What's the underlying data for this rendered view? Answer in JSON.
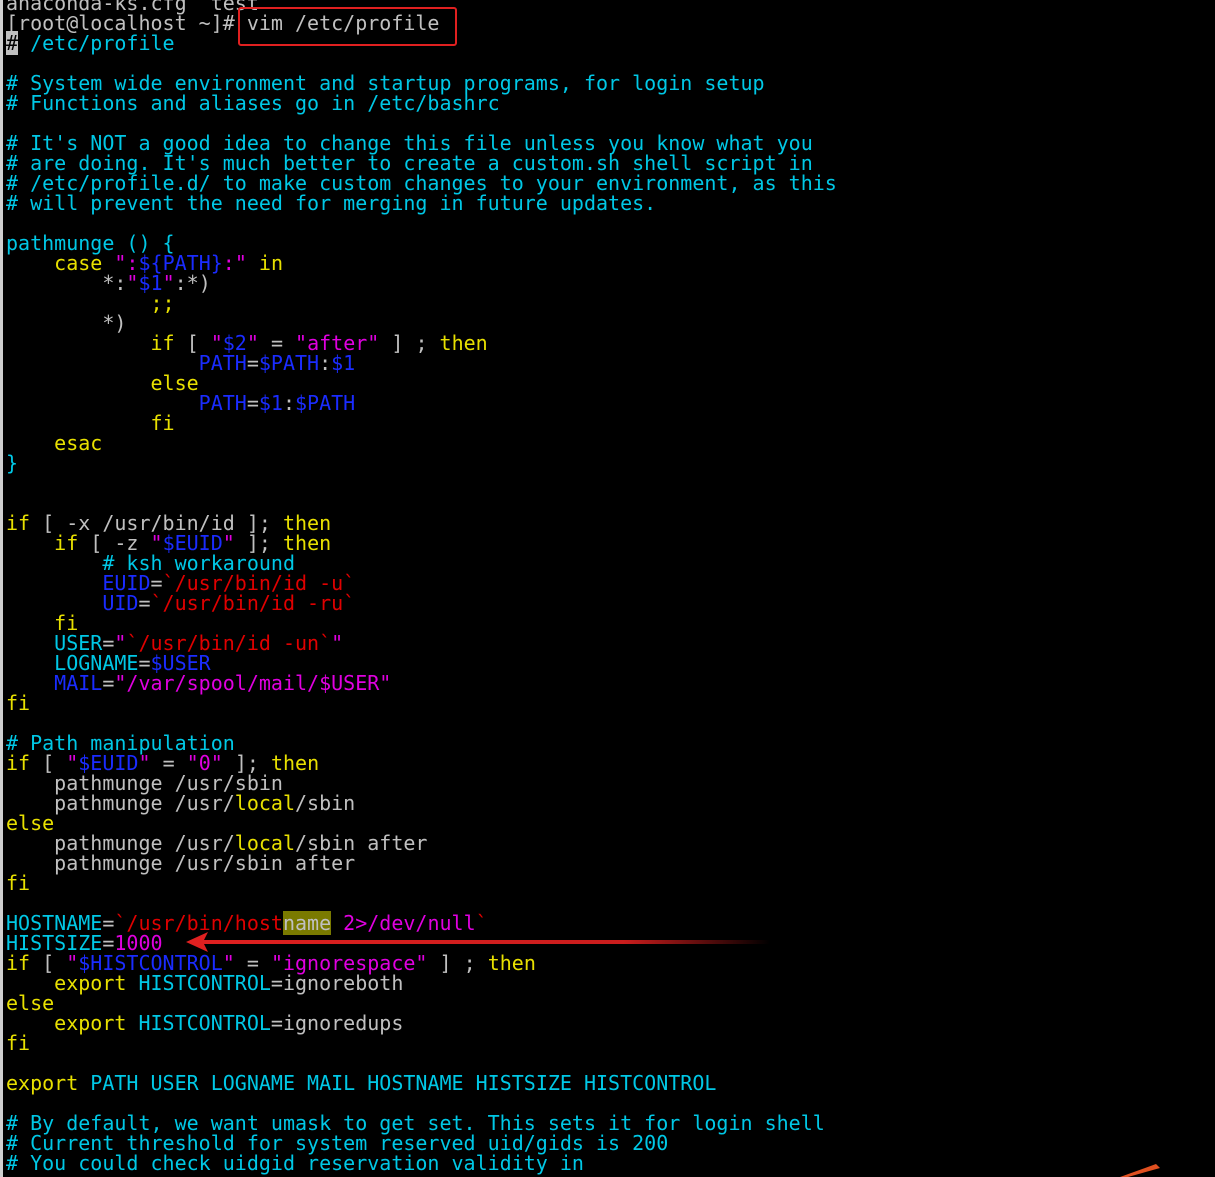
{
  "terminal": {
    "lines": [
      [
        [
          "default",
          "anaconda-ks.cfg  test"
        ]
      ],
      [
        [
          "default",
          "[root@localhost ~]# vim /etc/profile"
        ]
      ],
      [
        [
          "cursor",
          "#"
        ],
        [
          "comment",
          " /etc/profile"
        ]
      ],
      [],
      [
        [
          "comment",
          "# System wide environment and startup programs, for login setup"
        ]
      ],
      [
        [
          "comment",
          "# Functions and aliases go in /etc/bashrc"
        ]
      ],
      [],
      [
        [
          "comment",
          "# It's NOT a good idea to change this file unless you know what you"
        ]
      ],
      [
        [
          "comment",
          "# are doing. It's much better to create a custom.sh shell script in"
        ]
      ],
      [
        [
          "comment",
          "# /etc/profile.d/ to make custom changes to your environment, as this"
        ]
      ],
      [
        [
          "comment",
          "# will prevent the need for merging in future updates."
        ]
      ],
      [],
      [
        [
          "comment",
          "pathmunge () {"
        ]
      ],
      [
        [
          "default",
          "    "
        ],
        [
          "yellow",
          "case"
        ],
        [
          "default",
          " "
        ],
        [
          "str",
          "\":"
        ],
        [
          "var",
          "${PATH}"
        ],
        [
          "str",
          ":\""
        ],
        [
          "default",
          " "
        ],
        [
          "yellow",
          "in"
        ]
      ],
      [
        [
          "default",
          "        *:"
        ],
        [
          "str",
          "\""
        ],
        [
          "var",
          "$1"
        ],
        [
          "str",
          "\""
        ],
        [
          "default",
          ":*)"
        ]
      ],
      [
        [
          "default",
          "            "
        ],
        [
          "yellow",
          ";;"
        ]
      ],
      [
        [
          "default",
          "        *)"
        ]
      ],
      [
        [
          "default",
          "            "
        ],
        [
          "yellow",
          "if"
        ],
        [
          "default",
          " [ "
        ],
        [
          "str",
          "\""
        ],
        [
          "var",
          "$2"
        ],
        [
          "str",
          "\""
        ],
        [
          "default",
          " = "
        ],
        [
          "str",
          "\"after\""
        ],
        [
          "default",
          " ] ; "
        ],
        [
          "yellow",
          "then"
        ]
      ],
      [
        [
          "default",
          "                "
        ],
        [
          "var",
          "PATH"
        ],
        [
          "default",
          "="
        ],
        [
          "var",
          "$PATH"
        ],
        [
          "default",
          ":"
        ],
        [
          "var",
          "$1"
        ]
      ],
      [
        [
          "default",
          "            "
        ],
        [
          "yellow",
          "else"
        ]
      ],
      [
        [
          "default",
          "                "
        ],
        [
          "var",
          "PATH"
        ],
        [
          "default",
          "="
        ],
        [
          "var",
          "$1"
        ],
        [
          "default",
          ":"
        ],
        [
          "var",
          "$PATH"
        ]
      ],
      [
        [
          "default",
          "            "
        ],
        [
          "yellow",
          "fi"
        ]
      ],
      [
        [
          "default",
          "    "
        ],
        [
          "yellow",
          "esac"
        ]
      ],
      [
        [
          "comment",
          "}"
        ]
      ],
      [],
      [],
      [
        [
          "yellow",
          "if"
        ],
        [
          "default",
          " [ -x /usr/bin/id ]; "
        ],
        [
          "yellow",
          "then"
        ]
      ],
      [
        [
          "default",
          "    "
        ],
        [
          "yellow",
          "if"
        ],
        [
          "default",
          " [ -z "
        ],
        [
          "str",
          "\""
        ],
        [
          "var",
          "$EUID"
        ],
        [
          "str",
          "\""
        ],
        [
          "default",
          " ]; "
        ],
        [
          "yellow",
          "then"
        ]
      ],
      [
        [
          "default",
          "        "
        ],
        [
          "comment",
          "# ksh workaround"
        ]
      ],
      [
        [
          "default",
          "        "
        ],
        [
          "var",
          "EUID"
        ],
        [
          "default",
          "="
        ],
        [
          "red",
          "`/usr/bin/id -u`"
        ]
      ],
      [
        [
          "default",
          "        "
        ],
        [
          "var",
          "UID"
        ],
        [
          "default",
          "="
        ],
        [
          "red",
          "`/usr/bin/id -ru`"
        ]
      ],
      [
        [
          "default",
          "    "
        ],
        [
          "yellow",
          "fi"
        ]
      ],
      [
        [
          "default",
          "    "
        ],
        [
          "comment",
          "USER"
        ],
        [
          "default",
          "="
        ],
        [
          "str",
          "\""
        ],
        [
          "red",
          "`/usr/bin/id -un`"
        ],
        [
          "str",
          "\""
        ]
      ],
      [
        [
          "default",
          "    "
        ],
        [
          "comment",
          "LOGNAME"
        ],
        [
          "default",
          "="
        ],
        [
          "var",
          "$USER"
        ]
      ],
      [
        [
          "default",
          "    "
        ],
        [
          "var",
          "MAIL"
        ],
        [
          "default",
          "="
        ],
        [
          "str",
          "\"/var/spool/mail/$USER\""
        ]
      ],
      [
        [
          "yellow",
          "fi"
        ]
      ],
      [],
      [
        [
          "comment",
          "# Path manipulation"
        ]
      ],
      [
        [
          "yellow",
          "if"
        ],
        [
          "default",
          " [ "
        ],
        [
          "str",
          "\""
        ],
        [
          "var",
          "$EUID"
        ],
        [
          "str",
          "\""
        ],
        [
          "default",
          " = "
        ],
        [
          "str",
          "\"0\""
        ],
        [
          "default",
          " ]; "
        ],
        [
          "yellow",
          "then"
        ]
      ],
      [
        [
          "default",
          "    pathmunge /usr/sbin"
        ]
      ],
      [
        [
          "default",
          "    pathmunge /usr/"
        ],
        [
          "yellow",
          "local"
        ],
        [
          "default",
          "/sbin"
        ]
      ],
      [
        [
          "yellow",
          "else"
        ]
      ],
      [
        [
          "default",
          "    pathmunge /usr/"
        ],
        [
          "yellow",
          "local"
        ],
        [
          "default",
          "/sbin after"
        ]
      ],
      [
        [
          "default",
          "    pathmunge /usr/sbin after"
        ]
      ],
      [
        [
          "yellow",
          "fi"
        ]
      ],
      [],
      [
        [
          "comment",
          "HOSTNAME"
        ],
        [
          "default",
          "="
        ],
        [
          "red",
          "`/usr/bin/host"
        ],
        [
          "hl",
          "name"
        ],
        [
          "default",
          " "
        ],
        [
          "str",
          "2>/dev/null"
        ],
        [
          "red",
          "`"
        ]
      ],
      [
        [
          "comment",
          "HISTSIZE"
        ],
        [
          "default",
          "="
        ],
        [
          "str",
          "1000"
        ]
      ],
      [
        [
          "yellow",
          "if"
        ],
        [
          "default",
          " [ "
        ],
        [
          "str",
          "\""
        ],
        [
          "var",
          "$HISTCONTROL"
        ],
        [
          "str",
          "\""
        ],
        [
          "default",
          " = "
        ],
        [
          "str",
          "\"ignorespace\""
        ],
        [
          "default",
          " ] ; "
        ],
        [
          "yellow",
          "then"
        ]
      ],
      [
        [
          "default",
          "    "
        ],
        [
          "yellow",
          "export"
        ],
        [
          "default",
          " "
        ],
        [
          "comment",
          "HISTCONTROL"
        ],
        [
          "default",
          "=ignoreboth"
        ]
      ],
      [
        [
          "yellow",
          "else"
        ]
      ],
      [
        [
          "default",
          "    "
        ],
        [
          "yellow",
          "export"
        ],
        [
          "default",
          " "
        ],
        [
          "comment",
          "HISTCONTROL"
        ],
        [
          "default",
          "=ignoredups"
        ]
      ],
      [
        [
          "yellow",
          "fi"
        ]
      ],
      [],
      [
        [
          "yellow",
          "export"
        ],
        [
          "default",
          " "
        ],
        [
          "comment",
          "PATH USER LOGNAME MAIL HOSTNAME HISTSIZE HISTCONTROL"
        ]
      ],
      [],
      [
        [
          "comment",
          "# By default, we want umask to get set. This sets it for login shell"
        ]
      ],
      [
        [
          "comment",
          "# Current threshold for system reserved uid/gids is 200"
        ]
      ],
      [
        [
          "comment",
          "# You could check uidgid reservation validity in"
        ]
      ]
    ]
  },
  "annotations": {
    "command_box_color": "#e02020",
    "arrow_color": "#e02020"
  }
}
